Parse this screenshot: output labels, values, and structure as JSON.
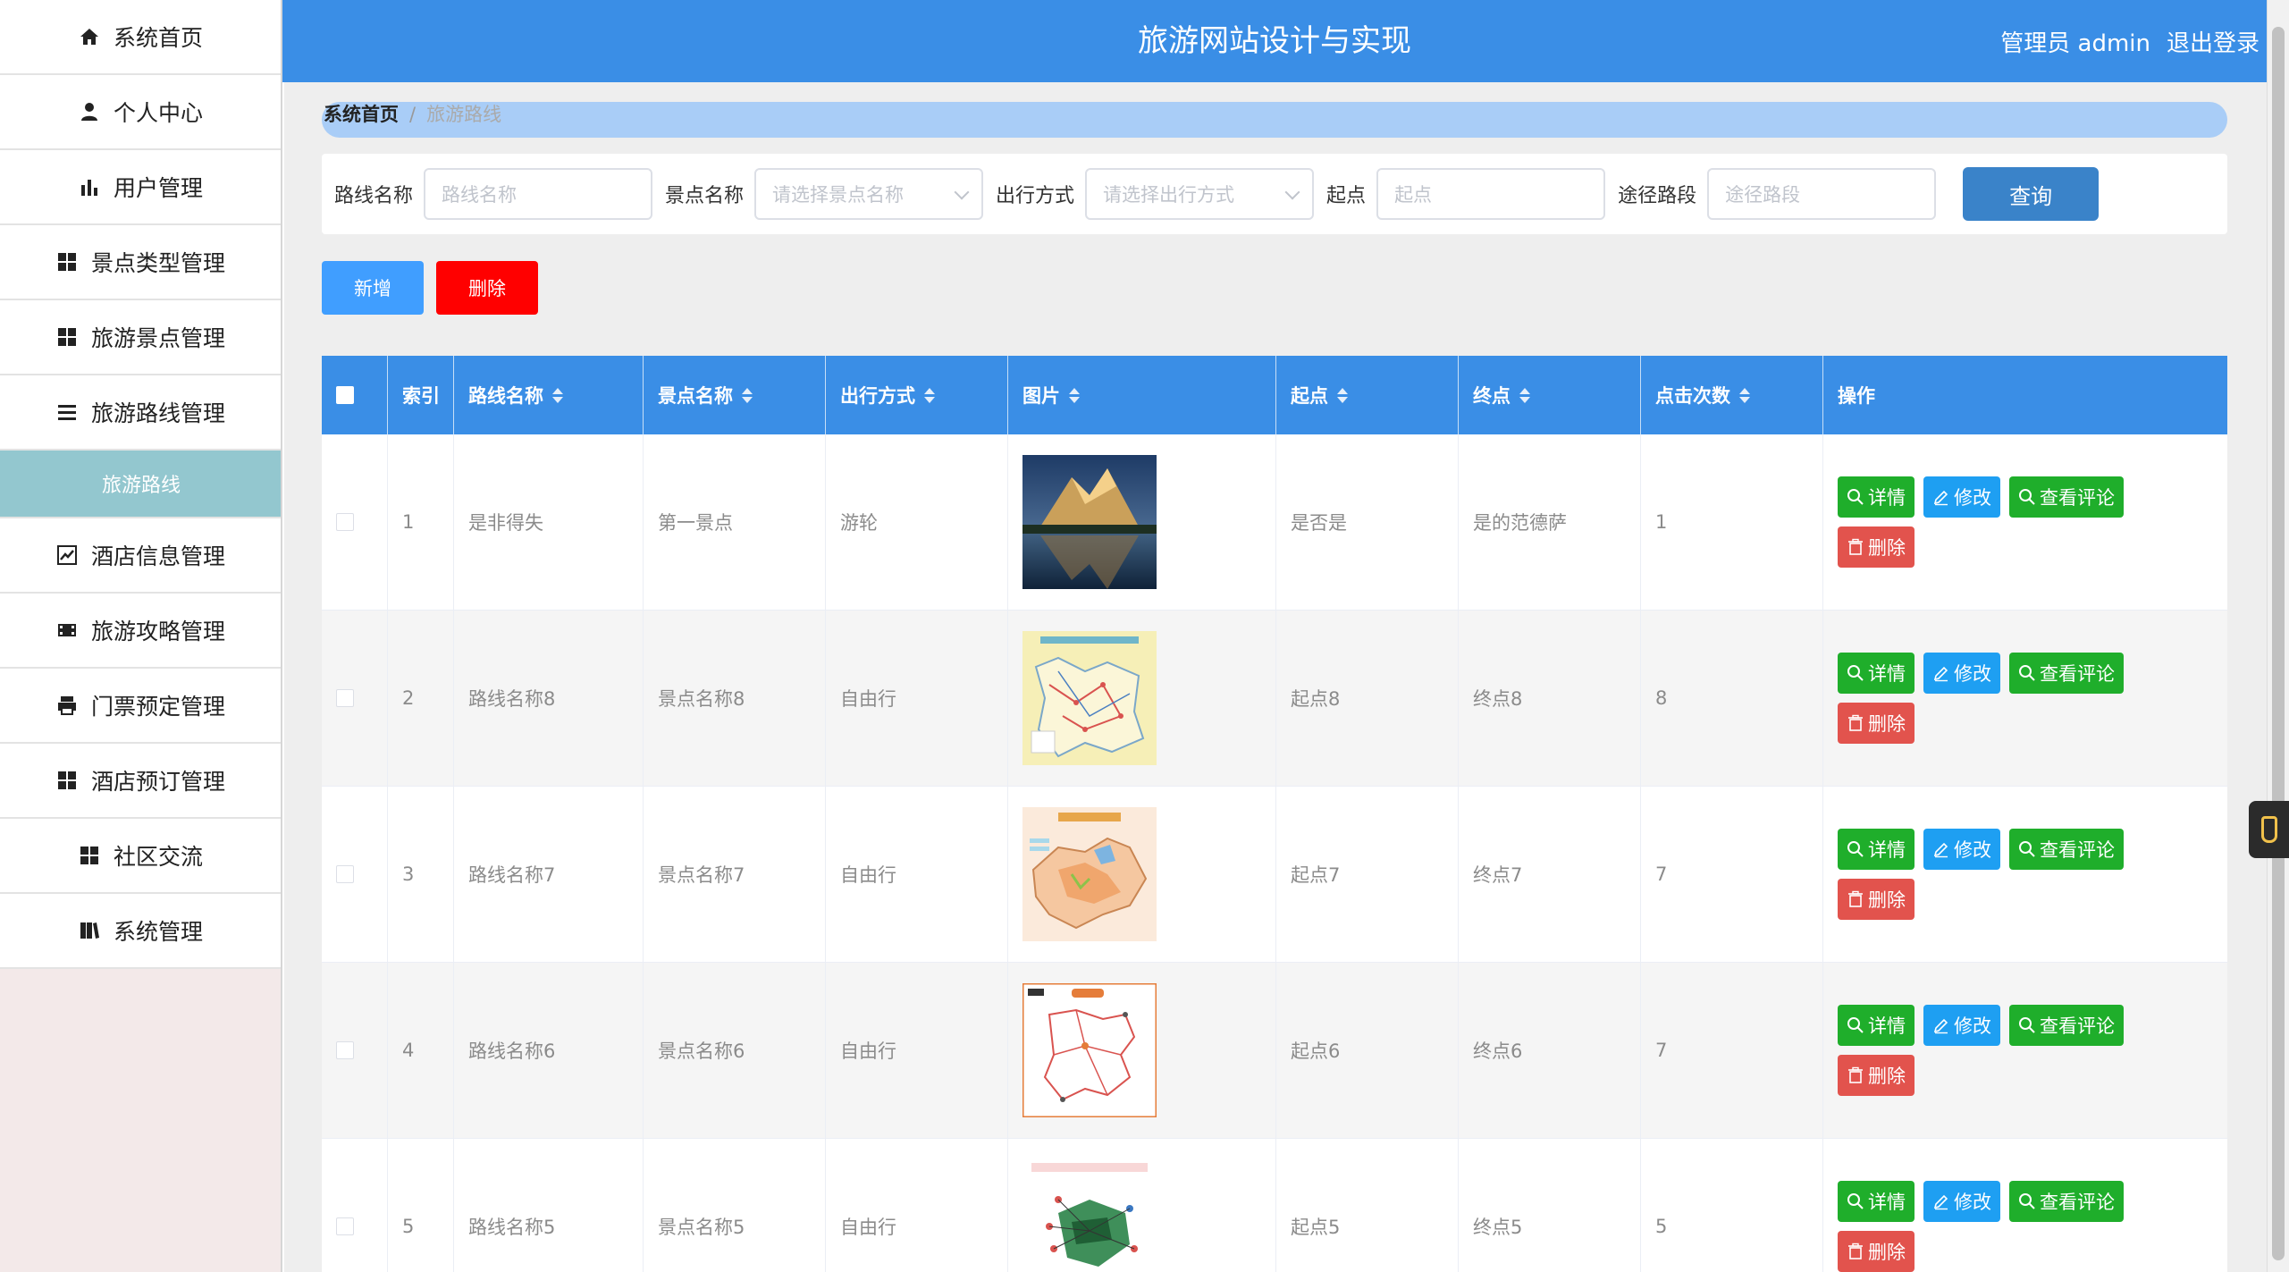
{
  "header": {
    "title": "旅游网站设计与实现",
    "user": "管理员 admin",
    "logout": "退出登录"
  },
  "sidebar": {
    "items": [
      {
        "label": "系统首页",
        "icon": "home-icon"
      },
      {
        "label": "个人中心",
        "icon": "person-icon"
      },
      {
        "label": "用户管理",
        "icon": "bar-chart-icon"
      },
      {
        "label": "景点类型管理",
        "icon": "grid-icon"
      },
      {
        "label": "旅游景点管理",
        "icon": "grid-icon"
      },
      {
        "label": "旅游路线管理",
        "icon": "list-icon"
      },
      {
        "label": "酒店信息管理",
        "icon": "line-chart-icon"
      },
      {
        "label": "旅游攻略管理",
        "icon": "film-icon"
      },
      {
        "label": "门票预定管理",
        "icon": "print-icon"
      },
      {
        "label": "酒店预订管理",
        "icon": "grid-icon"
      },
      {
        "label": "社区交流",
        "icon": "grid-icon"
      },
      {
        "label": "系统管理",
        "icon": "book-icon"
      }
    ],
    "submenu": {
      "label": "旅游路线"
    }
  },
  "breadcrumb": {
    "home": "系统首页",
    "separator": "/",
    "current": "旅游路线"
  },
  "filters": {
    "route_name": {
      "label": "路线名称",
      "placeholder": "路线名称"
    },
    "spot_name": {
      "label": "景点名称",
      "placeholder": "请选择景点名称"
    },
    "travel_mode": {
      "label": "出行方式",
      "placeholder": "请选择出行方式"
    },
    "start": {
      "label": "起点",
      "placeholder": "起点"
    },
    "route_path": {
      "label": "途径路段",
      "placeholder": "途径路段"
    },
    "search_button": "查询"
  },
  "actions": {
    "add": "新增",
    "delete": "删除"
  },
  "table": {
    "headers": [
      "索引",
      "路线名称",
      "景点名称",
      "出行方式",
      "图片",
      "起点",
      "终点",
      "点击次数",
      "操作"
    ],
    "rows": [
      {
        "index": "1",
        "route": "是非得失",
        "spot": "第一景点",
        "mode": "游轮",
        "start": "是否是",
        "end": "是的范德萨",
        "clicks": "1",
        "image": "mountain-lake-photo"
      },
      {
        "index": "2",
        "route": "路线名称8",
        "spot": "景点名称8",
        "mode": "自由行",
        "start": "起点8",
        "end": "终点8",
        "clicks": "8",
        "image": "route-map-yellow"
      },
      {
        "index": "3",
        "route": "路线名称7",
        "spot": "景点名称7",
        "mode": "自由行",
        "start": "起点7",
        "end": "终点7",
        "clicks": "7",
        "image": "region-map-orange"
      },
      {
        "index": "4",
        "route": "路线名称6",
        "spot": "景点名称6",
        "mode": "自由行",
        "start": "起点6",
        "end": "终点6",
        "clicks": "7",
        "image": "route-map-red"
      },
      {
        "index": "5",
        "route": "路线名称5",
        "spot": "景点名称5",
        "mode": "自由行",
        "start": "起点5",
        "end": "终点5",
        "clicks": "5",
        "image": "lijiang-hand-map"
      }
    ],
    "row_buttons": {
      "detail": "详情",
      "edit": "修改",
      "comments": "查看评论",
      "delete": "删除"
    }
  },
  "colors": {
    "header_bg": "#3a8ee6",
    "sidebar_active": "#93c7cf",
    "green": "#1fae2b",
    "blue": "#1e9ff2",
    "red": "#e2534d",
    "delete_red": "#ff0000"
  }
}
